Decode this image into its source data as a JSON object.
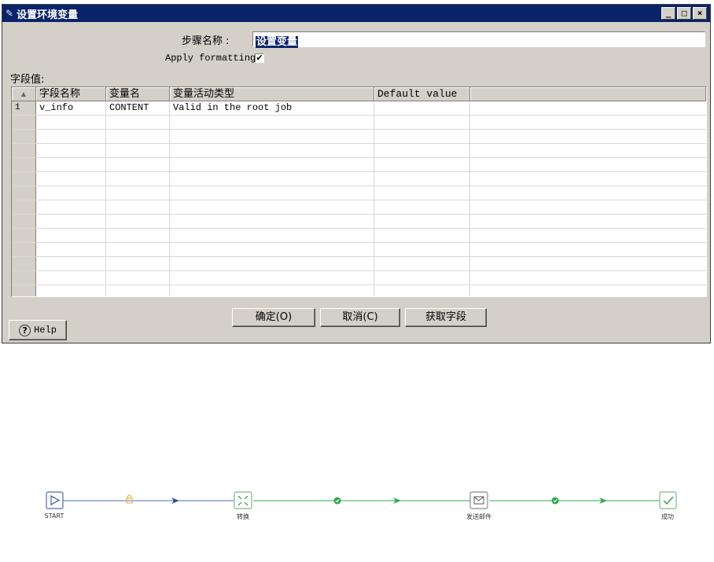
{
  "dialog": {
    "title": "设置环境变量",
    "stepname_label": "步骤名称 :",
    "stepname_value": "设置变量",
    "apply_formatting_label": "Apply formatting",
    "apply_formatting_checked": true,
    "apply_check_mark": "✔",
    "fields_label": "字段值:"
  },
  "grid": {
    "sort_marker": "▲",
    "headers": [
      "字段名称",
      "变量名",
      "变量活动类型",
      "Default value",
      ""
    ],
    "rows": [
      {
        "index": "1",
        "field_name": "v_info",
        "variable": "CONTENT",
        "scope": "Valid in the root job",
        "default": ""
      }
    ],
    "empty_row_count": 13
  },
  "buttons": {
    "ok": "确定(O)",
    "cancel": "取消(C)",
    "get_fields": "获取字段",
    "help": "Help",
    "help_icon": "?"
  },
  "window_controls": {
    "minimize": "_",
    "maximize": "□",
    "close": "×"
  },
  "flow": {
    "nodes": [
      {
        "label": "START",
        "icon": "play-icon"
      },
      {
        "label": "转换",
        "icon": "transform-icon"
      },
      {
        "label": "发送邮件",
        "icon": "mail-icon"
      },
      {
        "label": "成功",
        "icon": "check-icon"
      }
    ],
    "hop_colors": {
      "unconditional": "#4a6fb5",
      "success": "#2fa84f",
      "lock": "#e8a92a"
    }
  }
}
